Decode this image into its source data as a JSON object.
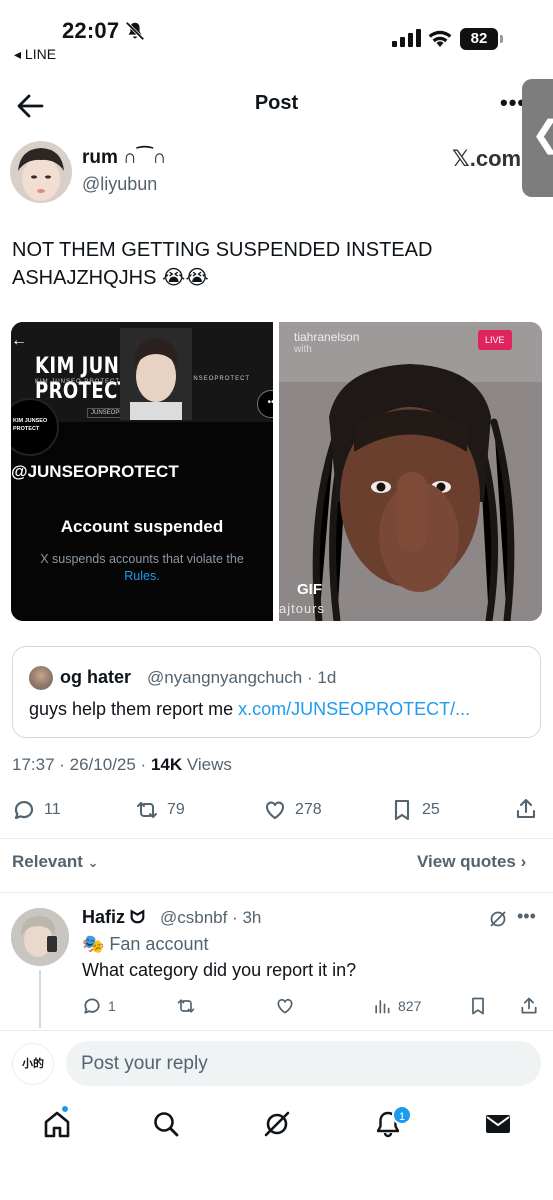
{
  "status_bar": {
    "time": "22:07",
    "back_app": "◂ LINE",
    "battery": "82"
  },
  "header": {
    "title": "Post",
    "more": "•••"
  },
  "post": {
    "author_name": "rum ∩⁀∩",
    "author_handle": "@liyubun",
    "brand": "𝕏.com",
    "text": "NOT THEM GETTING SUSPENDED INSTEAD ASHAJZHQJHS 😭😭",
    "media_left": {
      "banner_title": "KIM JUNSEO PROTECT",
      "banner_sub": "KIM JUNSEO PROTECT",
      "banner_sub2": "@JUNSEOPROTECT",
      "banner_email": "JUNSEOPROTECT@GMAIL.COM",
      "logo_text": "KIM JUNSEO PROTECT",
      "handle": "@JUNSEOPROTECT",
      "suspended_title": "Account suspended",
      "suspended_desc": "X suspends accounts that violate the",
      "rules_link": "Rules."
    },
    "media_right": {
      "streamer": "tiahranelson",
      "with_text": "with",
      "live": "LIVE",
      "gif_badge": "GIF",
      "watermark": "ajtours"
    },
    "quote": {
      "name": "og hater",
      "handle_time": "@nyangnyangchuch · 1d",
      "text": "guys help them report me ",
      "link": "x.com/JUNSEOPROTECT/..."
    },
    "meta_time": "17:37 · 26/10/25 · ",
    "views_count": "14K",
    "views_label": " Views",
    "actions": {
      "replies": "11",
      "reposts": "79",
      "likes": "278",
      "bookmarks": "25"
    }
  },
  "sort": {
    "relevant": "Relevant",
    "view_quotes": "View quotes"
  },
  "reply": {
    "name": "Hafiz ᗢ",
    "handle_time": "@csbnbf · 3h",
    "fan_label": "🎭 Fan account",
    "text": "What category did you report it in?",
    "replies": "1",
    "views": "827"
  },
  "compose": {
    "placeholder": "Post your reply",
    "my_avatar_text": "小的"
  },
  "nav": {
    "notifications_count": "1"
  },
  "colors": {
    "accent": "#1d9bf0",
    "muted": "#536471",
    "live": "#e0245e"
  }
}
